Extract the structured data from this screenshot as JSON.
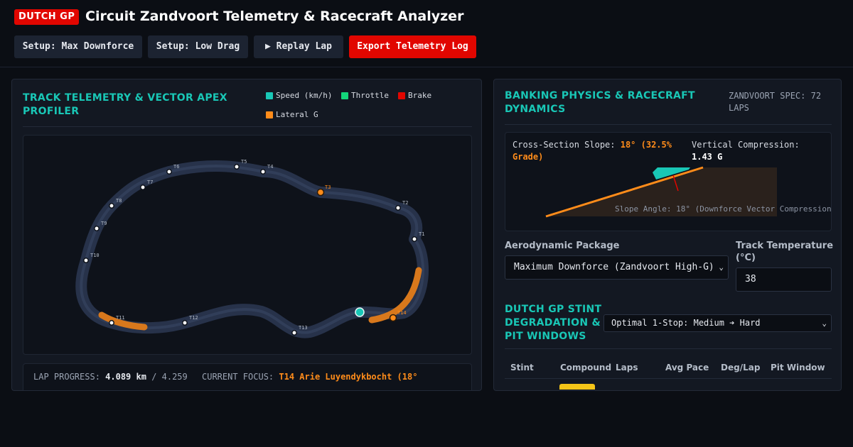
{
  "header": {
    "badge": "DUTCH GP",
    "title": "Circuit Zandvoort Telemetry & Racecraft Analyzer",
    "buttons": {
      "max_downforce": "Setup: Max Downforce",
      "low_drag": "Setup: Low Drag",
      "replay": "▶ Replay Lap",
      "export": "Export Telemetry Log"
    }
  },
  "left_panel": {
    "title": "TRACK TELEMETRY & VECTOR APEX PROFILER",
    "legend": [
      {
        "label": "Speed (km/h)",
        "color": "#19c7b6"
      },
      {
        "label": "Throttle",
        "color": "#13d67a"
      },
      {
        "label": "Brake",
        "color": "#e10600"
      },
      {
        "label": "Lateral G",
        "color": "#ff8c1a"
      }
    ],
    "turns": [
      "T1",
      "T2",
      "T3",
      "T4",
      "T5",
      "T6",
      "T7",
      "T8",
      "T9",
      "T10",
      "T11",
      "T12",
      "T13",
      "T14"
    ],
    "active_turns": [
      "T3",
      "T14"
    ],
    "status": {
      "progress_label": "LAP PROGRESS:",
      "progress_value": "4.089 km",
      "progress_total": "/ 4.259",
      "focus_label": "CURRENT FOCUS:",
      "focus_value": "T14 Arie Luyendykbocht (18°"
    }
  },
  "right_panel": {
    "title": "BANKING PHYSICS & RACECRAFT DYNAMICS",
    "spec": "ZANDVOORT SPEC: 72 LAPS",
    "physics": {
      "slope_label": "Cross-Section Slope:",
      "slope_value": "18° (32.5% Grade)",
      "compression_label": "Vertical Compression:",
      "compression_value": "1.43 G",
      "caption": "Slope Angle: 18° (Downforce Vector Compression"
    },
    "aero": {
      "label": "Aerodynamic Package",
      "value": "Maximum Downforce (Zandvoort High-G)"
    },
    "temp": {
      "label": "Track Temperature (°C)",
      "value": "38"
    },
    "stint": {
      "title": "DUTCH GP STINT DEGRADATION & PIT WINDOWS",
      "strategy": "Optimal 1-Stop: Medium ➔ Hard",
      "columns": [
        "Stint",
        "Compound",
        "Laps",
        "Avg Pace",
        "Deg/Lap",
        "Pit Window"
      ],
      "first_compound_color": "#f5c518"
    }
  }
}
